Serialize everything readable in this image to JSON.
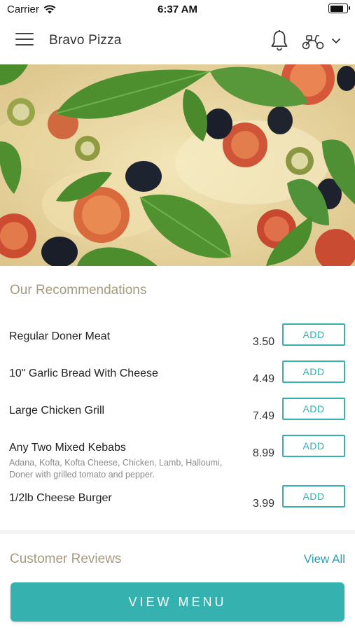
{
  "status_bar": {
    "carrier": "Carrier",
    "time": "6:37 AM",
    "battery_level": 0.9
  },
  "header": {
    "title": "Bravo Pizza",
    "icons": [
      "menu-icon",
      "bell-icon",
      "scooter-icon",
      "chevron-down-icon"
    ]
  },
  "hero": {
    "image": "pizza-with-basil-olives-tomatoes"
  },
  "recommendations": {
    "title": "Our Recommendations",
    "items": [
      {
        "name": "Regular Doner Meat",
        "description": "",
        "price": "3.50",
        "button": "ADD"
      },
      {
        "name": "10\" Garlic Bread With Cheese",
        "description": "",
        "price": "4.49",
        "button": "ADD"
      },
      {
        "name": "Large Chicken Grill",
        "description": "",
        "price": "7.49",
        "button": "ADD"
      },
      {
        "name": "Any Two Mixed Kebabs",
        "description": "Adana, Kofta, Kofta Cheese, Chicken, Lamb, Halloumi, Doner with grilled tomato and pepper.",
        "price": "8.99",
        "button": "ADD"
      },
      {
        "name": "1/2lb Cheese Burger",
        "description": "",
        "price": "3.99",
        "button": "ADD"
      }
    ]
  },
  "reviews": {
    "title": "Customer Reviews",
    "view_all": "View All"
  },
  "cta": {
    "label": "VIEW MENU"
  },
  "colors": {
    "accent": "#35b2b0",
    "link": "#2c9fb2",
    "section_title": "#a59a7f"
  }
}
